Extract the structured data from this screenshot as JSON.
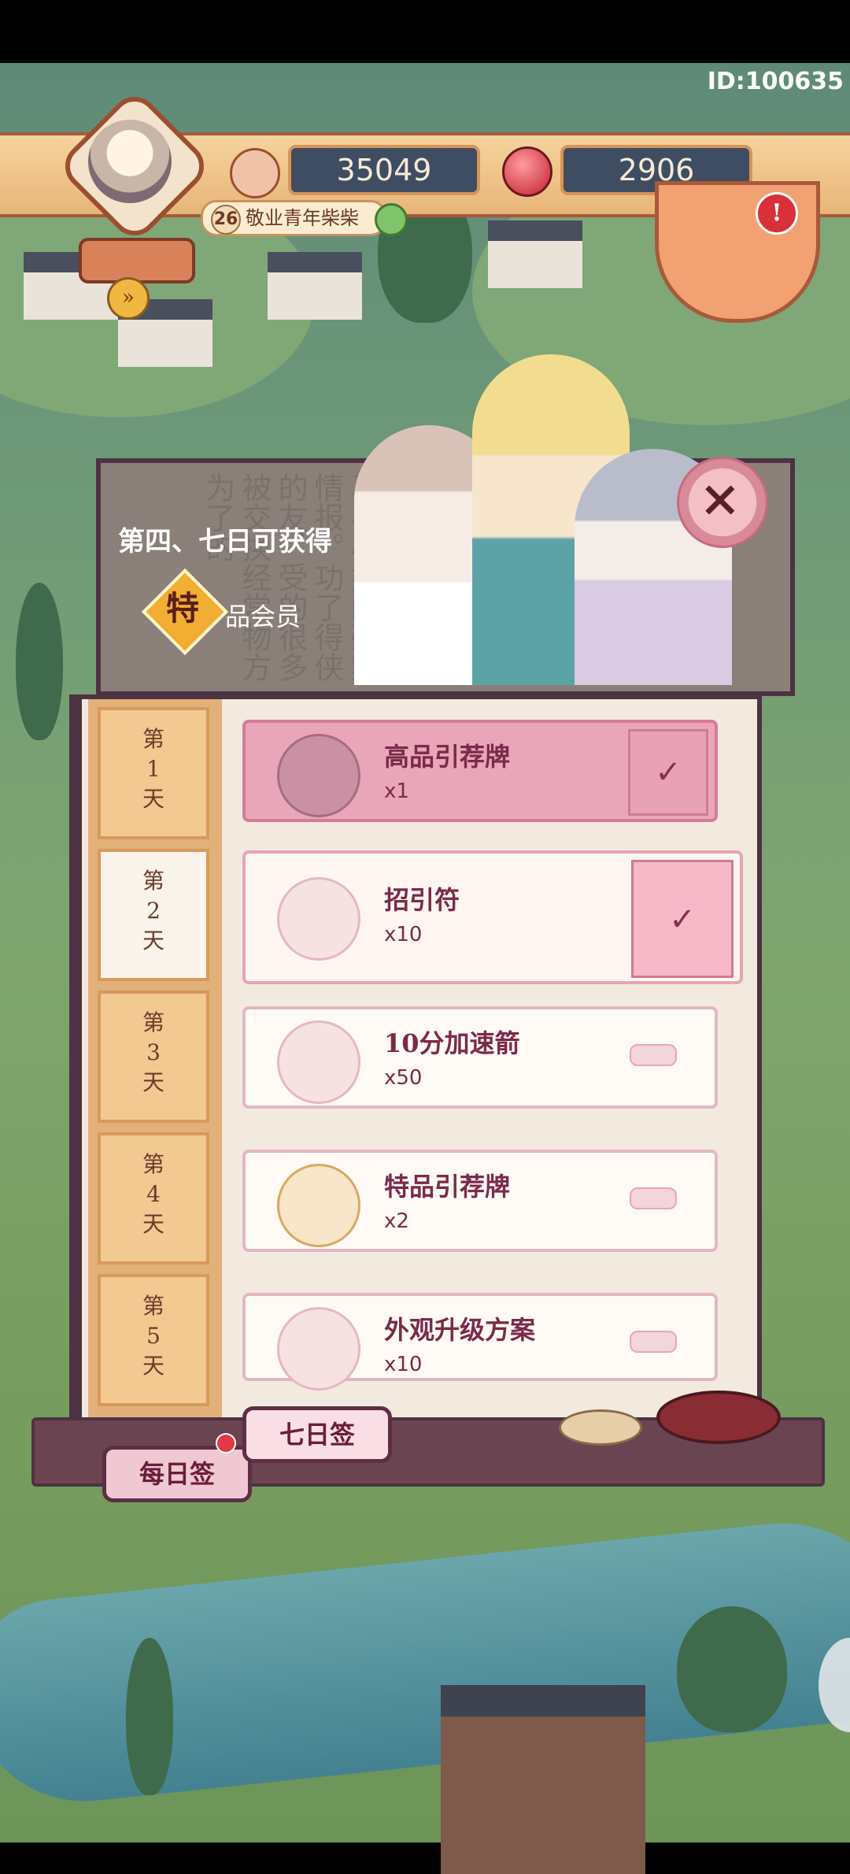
{
  "header": {
    "player_id": "ID:100635",
    "currency1_value": "35049",
    "currency2_value": "2906",
    "level": "26",
    "player_title": "敬业青年柴柴",
    "currency1_icon": "mushroom-icon",
    "currency2_icon": "red-gem-icon"
  },
  "banner": {
    "title": "第四、七日可获得",
    "badge_char": "特",
    "subtitle": "品会员",
    "background_text": "马县小姐的殊案情报。功了得侠的友，受的很多被交换经常物方为了的"
  },
  "days": [
    {
      "label": "第\n1\n天",
      "active": false
    },
    {
      "label": "第\n2\n天",
      "active": true
    },
    {
      "label": "第\n3\n天",
      "active": false
    },
    {
      "label": "第\n4\n天",
      "active": false
    },
    {
      "label": "第\n5\n天",
      "active": false
    }
  ],
  "rewards": [
    {
      "name": "高品引荐牌",
      "count": "x1",
      "state": "claimed",
      "icon": "seal-bag-icon"
    },
    {
      "name": "招引符",
      "count": "x10",
      "state": "today",
      "icon": "talisman-icon"
    },
    {
      "name": "10分加速箭",
      "count": "x50",
      "state": "pending",
      "icon": "arrow-icon"
    },
    {
      "name": "特品引荐牌",
      "count": "x2",
      "state": "pending",
      "icon": "gold-seal-bag-icon"
    },
    {
      "name": "外观升级方案",
      "count": "x10",
      "state": "pending",
      "icon": "scroll-icon"
    }
  ],
  "tabs": {
    "daily": "每日签",
    "seven_day": "七日签"
  },
  "colors": {
    "accent_pink": "#e9a6b8",
    "frame_purple": "#4c3242",
    "header_orange": "#e8b579"
  }
}
